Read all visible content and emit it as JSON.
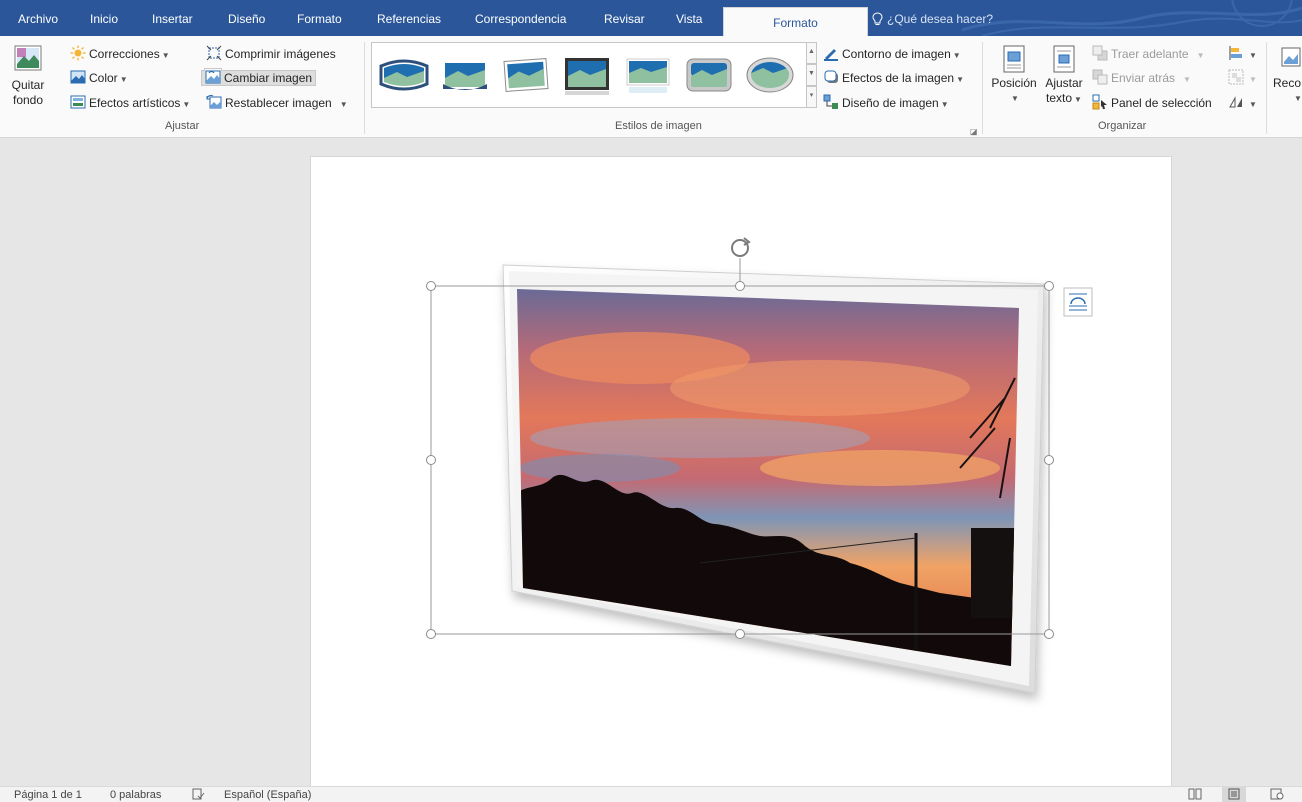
{
  "tabs": {
    "archivo": "Archivo",
    "inicio": "Inicio",
    "insertar": "Insertar",
    "diseno": "Diseño",
    "formato1": "Formato",
    "referencias": "Referencias",
    "correspondencia": "Correspondencia",
    "revisar": "Revisar",
    "vista": "Vista",
    "formato_active": "Formato",
    "tellme": "¿Qué desea hacer?"
  },
  "ajustar": {
    "quitar_fondo_1": "Quitar",
    "quitar_fondo_2": "fondo",
    "correcciones": "Correcciones",
    "color": "Color",
    "efectos_artisticos": "Efectos artísticos",
    "comprimir": "Comprimir imágenes",
    "cambiar": "Cambiar imagen",
    "restablecer": "Restablecer imagen",
    "group_label": "Ajustar"
  },
  "estilos": {
    "contorno": "Contorno de imagen",
    "efectos": "Efectos de la imagen",
    "diseno": "Diseño de imagen",
    "group_label": "Estilos de imagen"
  },
  "organizar": {
    "posicion": "Posición",
    "ajustar_1": "Ajustar",
    "ajustar_2": "texto",
    "traer": "Traer adelante",
    "enviar": "Enviar atrás",
    "panel": "Panel de selección",
    "group_label": "Organizar"
  },
  "tamano": {
    "recortar_partial": "Reco"
  },
  "status": {
    "page": "Página 1 de 1",
    "words": "0 palabras",
    "language": "Español (España)"
  },
  "colors": {
    "accent": "#2b579a",
    "ribbon_bg": "#fafafa",
    "doc_bg": "#e6e6e6"
  }
}
